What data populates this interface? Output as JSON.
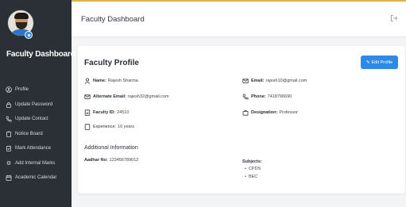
{
  "sidebar": {
    "brand": "Faculty Dashboard",
    "items": [
      {
        "label": "Profile",
        "icon": "user-circle-icon"
      },
      {
        "label": "Update Password",
        "icon": "lock-icon"
      },
      {
        "label": "Update Contact",
        "icon": "phone-icon"
      },
      {
        "label": "Notice Board",
        "icon": "clipboard-icon"
      },
      {
        "label": "Mark Attendance",
        "icon": "clipboard-check-icon"
      },
      {
        "label": "Add Internal Marks",
        "icon": "gear-icon"
      },
      {
        "label": "Academic Calendar",
        "icon": "calendar-icon"
      }
    ]
  },
  "header": {
    "title": "Faculty Dashboard",
    "logout_icon": "logout-icon"
  },
  "profile": {
    "title": "Faculty Profile",
    "edit_label": "Edit Profile",
    "name_label": "Name:",
    "name_value": "Rajesh Sharma",
    "alt_email_label": "Alternate Email:",
    "alt_email_value": "rajesh32@gmail.com",
    "faculty_id_label": "Faculty ID:",
    "faculty_id_value": "24510",
    "experience_label": "Experience:",
    "experience_value": "10 years",
    "email_label": "Email:",
    "email_value": "rajesh10@gmail.com",
    "phone_label": "Phone:",
    "phone_value": "7418796690",
    "designation_label": "Designation:",
    "designation_value": "Professor",
    "additional_title": "Additional Information",
    "aadhar_label": "Aadhar No:",
    "aadhar_value": "123456789012",
    "subjects_label": "Subjects:",
    "subjects": [
      "CPDS",
      "BEC"
    ]
  },
  "colors": {
    "sidebar_bg": "#2b3036",
    "accent": "#2f8ae6",
    "page_bg": "#f3f4f6"
  }
}
